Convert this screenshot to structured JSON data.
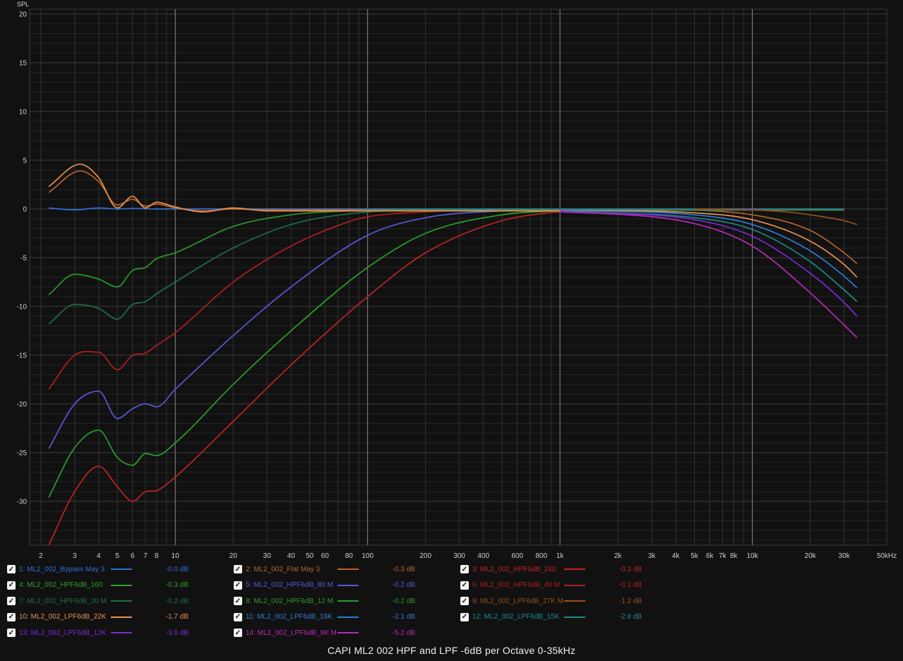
{
  "chart_data": {
    "type": "line",
    "title": "CAPI ML2 002 HPF and LPF -6dB per Octave 0-35kHz",
    "ylabel": "SPL",
    "xlabel": "",
    "x_scale": "log",
    "xlim": [
      1.75,
      50000
    ],
    "ylim": [
      -34.5,
      20.5
    ],
    "grid": true,
    "y_ticks": [
      "20",
      "15",
      "10",
      "5",
      "0",
      "-5",
      "-10",
      "-15",
      "-20",
      "-25",
      "-30"
    ],
    "x_ticks": [
      {
        "f": 2,
        "label": "2"
      },
      {
        "f": 3,
        "label": "3"
      },
      {
        "f": 4,
        "label": "4"
      },
      {
        "f": 5,
        "label": "5"
      },
      {
        "f": 6,
        "label": "6"
      },
      {
        "f": 7,
        "label": "7"
      },
      {
        "f": 8,
        "label": "8"
      },
      {
        "f": 10,
        "label": "10"
      },
      {
        "f": 20,
        "label": "20"
      },
      {
        "f": 30,
        "label": "30"
      },
      {
        "f": 40,
        "label": "40"
      },
      {
        "f": 50,
        "label": "50"
      },
      {
        "f": 60,
        "label": "60"
      },
      {
        "f": 80,
        "label": "80"
      },
      {
        "f": 100,
        "label": "100"
      },
      {
        "f": 200,
        "label": "200"
      },
      {
        "f": 300,
        "label": "300"
      },
      {
        "f": 400,
        "label": "400"
      },
      {
        "f": 600,
        "label": "600"
      },
      {
        "f": 800,
        "label": "800"
      },
      {
        "f": 1000,
        "label": "1k"
      },
      {
        "f": 2000,
        "label": "2k"
      },
      {
        "f": 3000,
        "label": "3k"
      },
      {
        "f": 4000,
        "label": "4k"
      },
      {
        "f": 5000,
        "label": "5k"
      },
      {
        "f": 6000,
        "label": "6k"
      },
      {
        "f": 7000,
        "label": "7k"
      },
      {
        "f": 8000,
        "label": "8k"
      },
      {
        "f": 10000,
        "label": "10k"
      },
      {
        "f": 20000,
        "label": "20k"
      },
      {
        "f": 30000,
        "label": "30k"
      },
      {
        "f": 50000,
        "label": "50kHz"
      }
    ],
    "series": [
      {
        "name": "1: ML2_002_Bypass May 3",
        "value": "-0.0 dB",
        "color": "#2e6fd6",
        "x": [
          2.2,
          3,
          4,
          5,
          6,
          8,
          10,
          20,
          30000
        ],
        "y": [
          0.1,
          -0.1,
          0.1,
          0.0,
          0.05,
          0.0,
          0.0,
          0.0,
          0.0
        ]
      },
      {
        "name": "2: ML2_002_Flat May 3",
        "value": "-0.3 dB",
        "color": "#b8642e",
        "x": [
          2.2,
          3.2,
          4,
          5,
          6,
          7,
          8,
          10,
          14,
          20,
          30,
          3000,
          10000,
          20000,
          30000,
          35000
        ],
        "y": [
          1.7,
          3.9,
          2.8,
          0.4,
          1.0,
          0.3,
          0.5,
          0.1,
          -0.2,
          0.0,
          -0.1,
          -0.1,
          -0.6,
          -2.2,
          -4.5,
          -5.6
        ]
      },
      {
        "name": "3: ML2_002_HPF6dB_240",
        "value": "-0.3 dB",
        "color": "#c02222",
        "x": [
          2.2,
          3,
          4,
          5,
          6,
          7,
          8,
          10,
          20,
          40,
          100,
          200,
          500,
          1000,
          2000,
          30000
        ],
        "y": [
          -34.5,
          -29,
          -26.4,
          -28.5,
          -30,
          -29,
          -28.9,
          -27.5,
          -21.8,
          -16,
          -9,
          -4.5,
          -1.2,
          -0.3,
          -0.1,
          -0.1
        ]
      },
      {
        "name": "4: ML2_002_HPF6dB_160",
        "value": "-0.3 dB",
        "color": "#2aa02a",
        "x": [
          2.2,
          3,
          4,
          5,
          6,
          7,
          8,
          10,
          20,
          40,
          100,
          200,
          500,
          1000,
          2000,
          30000
        ],
        "y": [
          -29.6,
          -24.5,
          -22.7,
          -25.5,
          -26.3,
          -25.1,
          -25.3,
          -24,
          -18,
          -12.5,
          -6,
          -2.5,
          -0.6,
          -0.2,
          -0.1,
          -0.1
        ]
      },
      {
        "name": "5: ML2_002_HPF6dB_80 M",
        "value": "-0.2 dB",
        "color": "#5858d8",
        "x": [
          2.2,
          3,
          4,
          5,
          6,
          7,
          8,
          10,
          20,
          40,
          100,
          200,
          500,
          1000,
          30000
        ],
        "y": [
          -24.6,
          -20,
          -18.7,
          -21.5,
          -20.5,
          -20,
          -20.3,
          -18.5,
          -13,
          -8,
          -2.7,
          -0.9,
          -0.2,
          -0.1,
          -0.1
        ]
      },
      {
        "name": "6: ML2_002_HPF6dB_40 M",
        "value": "-0.2 dB",
        "color": "#b01e1e",
        "x": [
          2.2,
          3,
          4,
          5,
          6,
          7,
          8,
          10,
          20,
          40,
          80,
          100,
          200,
          500,
          30000
        ],
        "y": [
          -18.5,
          -15,
          -14.7,
          -16.5,
          -15,
          -14.8,
          -14,
          -12.7,
          -7.5,
          -3.8,
          -1.3,
          -0.8,
          -0.3,
          -0.1,
          -0.1
        ]
      },
      {
        "name": "7: ML2_002_HPF6dB_20 M",
        "value": "-0.2 dB",
        "color": "#1e6e46",
        "x": [
          2.2,
          3,
          4,
          5,
          6,
          7,
          8,
          10,
          20,
          40,
          80,
          200,
          30000
        ],
        "y": [
          -11.8,
          -9.8,
          -10.2,
          -11.3,
          -9.8,
          -9.5,
          -8.7,
          -7.5,
          -4,
          -1.6,
          -0.5,
          -0.1,
          -0.1
        ]
      },
      {
        "name": "8: ML2_002_HPF6dB_12 M",
        "value": "-0.2 dB",
        "color": "#2a9a2a",
        "x": [
          2.2,
          3,
          4,
          5,
          6,
          7,
          8,
          10,
          20,
          40,
          80,
          200,
          30000
        ],
        "y": [
          -8.8,
          -6.7,
          -7.2,
          -8,
          -6.3,
          -6,
          -5.1,
          -4.5,
          -1.8,
          -0.6,
          -0.2,
          -0.1,
          -0.1
        ]
      },
      {
        "name": "9: ML2_002_LPF6dB_27K M",
        "value": "-1.2 dB",
        "color": "#9a4e1e",
        "x": [
          5000,
          10000,
          15000,
          20000,
          30000,
          35000
        ],
        "y": [
          0.0,
          -0.1,
          -0.3,
          -0.6,
          -1.2,
          -1.6
        ]
      },
      {
        "name": "10: ML2_002_LPF6dB_22K",
        "value": "-1.7 dB",
        "color": "#e89050",
        "x": [
          2.2,
          3.2,
          4,
          5,
          6,
          7,
          8,
          10,
          14,
          20,
          30,
          1000,
          5000,
          10000,
          20000,
          30000,
          35000
        ],
        "y": [
          2.3,
          4.6,
          3.2,
          0.1,
          1.3,
          0.1,
          0.7,
          0.2,
          -0.3,
          0.1,
          -0.2,
          -0.2,
          -0.4,
          -1.1,
          -3.3,
          -5.7,
          -7.0
        ]
      },
      {
        "name": "11: ML2_002_LPF6dB_18K",
        "value": "-2.1 dB",
        "color": "#2e7ad6",
        "x": [
          1000,
          5000,
          10000,
          20000,
          30000,
          35000
        ],
        "y": [
          -0.2,
          -0.6,
          -1.6,
          -4.3,
          -6.9,
          -8.1
        ]
      },
      {
        "name": "12: ML2_002_LPF6dB_15K",
        "value": "-2.8 dB",
        "color": "#1e8a8a",
        "x": [
          1000,
          5000,
          10000,
          20000,
          30000,
          35000
        ],
        "y": [
          -0.3,
          -0.9,
          -2.1,
          -5.4,
          -8.3,
          -9.5
        ]
      },
      {
        "name": "13: ML2_002_LPF6dB_12K",
        "value": "-3.6 dB",
        "color": "#7a2ad6",
        "x": [
          1000,
          5000,
          10000,
          20000,
          30000,
          35000
        ],
        "y": [
          -0.3,
          -1.1,
          -2.8,
          -6.6,
          -9.6,
          -11.0
        ]
      },
      {
        "name": "14: ML2_002_LPF6dB_9K M",
        "value": "-5.2 dB",
        "color": "#b82ab8",
        "x": [
          1000,
          5000,
          10000,
          20000,
          30000,
          35000
        ],
        "y": [
          -0.2,
          -1.5,
          -3.8,
          -8.6,
          -11.9,
          -13.2
        ]
      }
    ]
  },
  "legend_grid": [
    [
      1,
      2,
      3
    ],
    [
      4,
      5,
      6
    ],
    [
      7,
      8,
      9
    ],
    [
      10,
      11,
      12
    ],
    [
      13,
      14,
      null
    ]
  ]
}
